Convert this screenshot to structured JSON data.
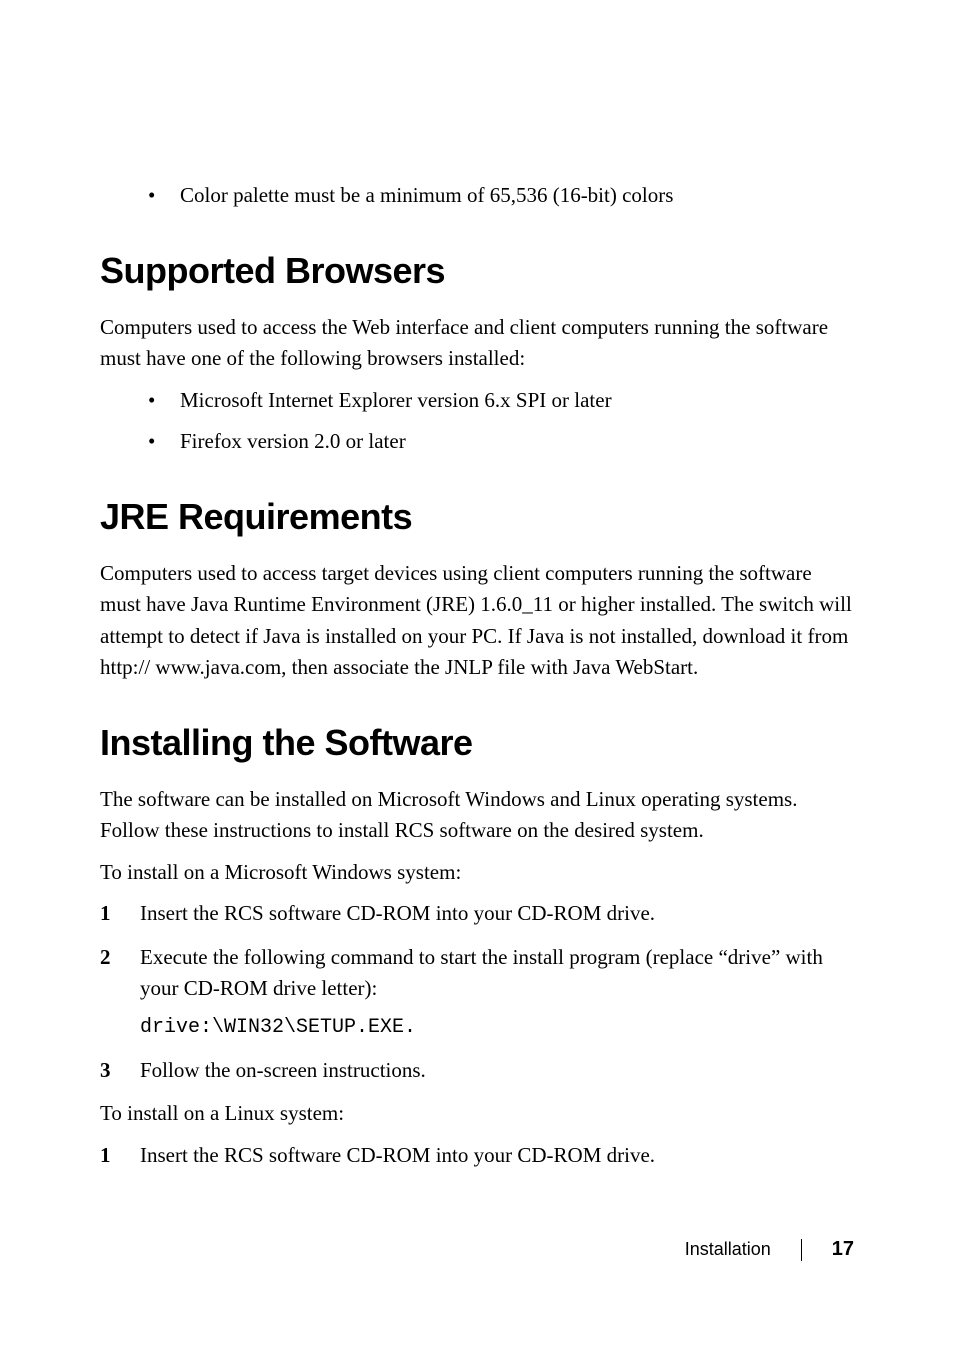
{
  "lead_bullet": "Color palette must be a minimum of 65,536 (16-bit) colors",
  "sections": {
    "supported_browsers": {
      "heading": "Supported Browsers",
      "intro": "Computers used to access the Web interface and client computers running the software must have one of the following browsers installed:",
      "bullets": [
        "Microsoft Internet Explorer version 6.x SPI or later",
        "Firefox version 2.0 or later"
      ]
    },
    "jre": {
      "heading": "JRE Requirements",
      "body": "Computers used to access target devices using client computers running the software must have Java Runtime Environment (JRE) 1.6.0_11 or higher installed. The switch will attempt to detect if Java is installed on your PC. If Java is not installed, download it from http:// www.java.com, then associate the JNLP file with Java WebStart."
    },
    "install": {
      "heading": "Installing the Software",
      "intro": "The software can be installed on Microsoft Windows and Linux operating systems. Follow these instructions to install RCS software on the desired system.",
      "windows_label": "To install on a Microsoft Windows system:",
      "windows_steps": [
        {
          "num": "1",
          "text": "Insert the RCS software CD-ROM into your CD-ROM drive."
        },
        {
          "num": "2",
          "text": "Execute the following command to start the install program (replace “drive” with your CD-ROM drive letter):",
          "code": "drive:\\WIN32\\SETUP.EXE."
        },
        {
          "num": "3",
          "text": "Follow the on-screen instructions."
        }
      ],
      "linux_label": "To install on a Linux system:",
      "linux_steps": [
        {
          "num": "1",
          "text": "Insert the RCS software CD-ROM into your CD-ROM drive."
        }
      ]
    }
  },
  "footer": {
    "section": "Installation",
    "page": "17"
  }
}
